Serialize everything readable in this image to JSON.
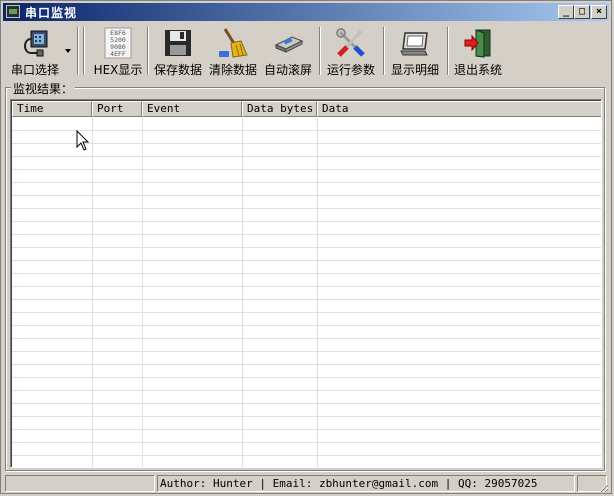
{
  "window": {
    "title": "串口监视"
  },
  "title_buttons": {
    "minimize": "_",
    "maximize": "□",
    "close": "×"
  },
  "toolbar": {
    "items": [
      {
        "label": "串口选择",
        "icon": "serial-port-icon"
      },
      {
        "label": "HEX显示",
        "icon": "hex-icon"
      },
      {
        "label": "保存数据",
        "icon": "floppy-disk-icon"
      },
      {
        "label": "清除数据",
        "icon": "broom-icon"
      },
      {
        "label": "自动滚屏",
        "icon": "auto-scroll-icon"
      },
      {
        "label": "运行参数",
        "icon": "tools-icon"
      },
      {
        "label": "显示明细",
        "icon": "display-details-icon"
      },
      {
        "label": "退出系统",
        "icon": "exit-door-icon"
      }
    ],
    "hex_text": [
      "E8F6",
      "5200",
      "9080",
      "4EFF"
    ]
  },
  "results": {
    "label": "监视结果：",
    "columns": [
      "Time",
      "Port",
      "Event",
      "Data bytes",
      "Data"
    ],
    "rows": []
  },
  "status": {
    "pane1": "",
    "pane2": "Author: Hunter | Email: zbhunter@gmail.com | QQ: 29057025",
    "pane3": ""
  },
  "colors": {
    "title_start": "#0a246a",
    "title_end": "#a6caf0",
    "face": "#d4d0c8"
  }
}
